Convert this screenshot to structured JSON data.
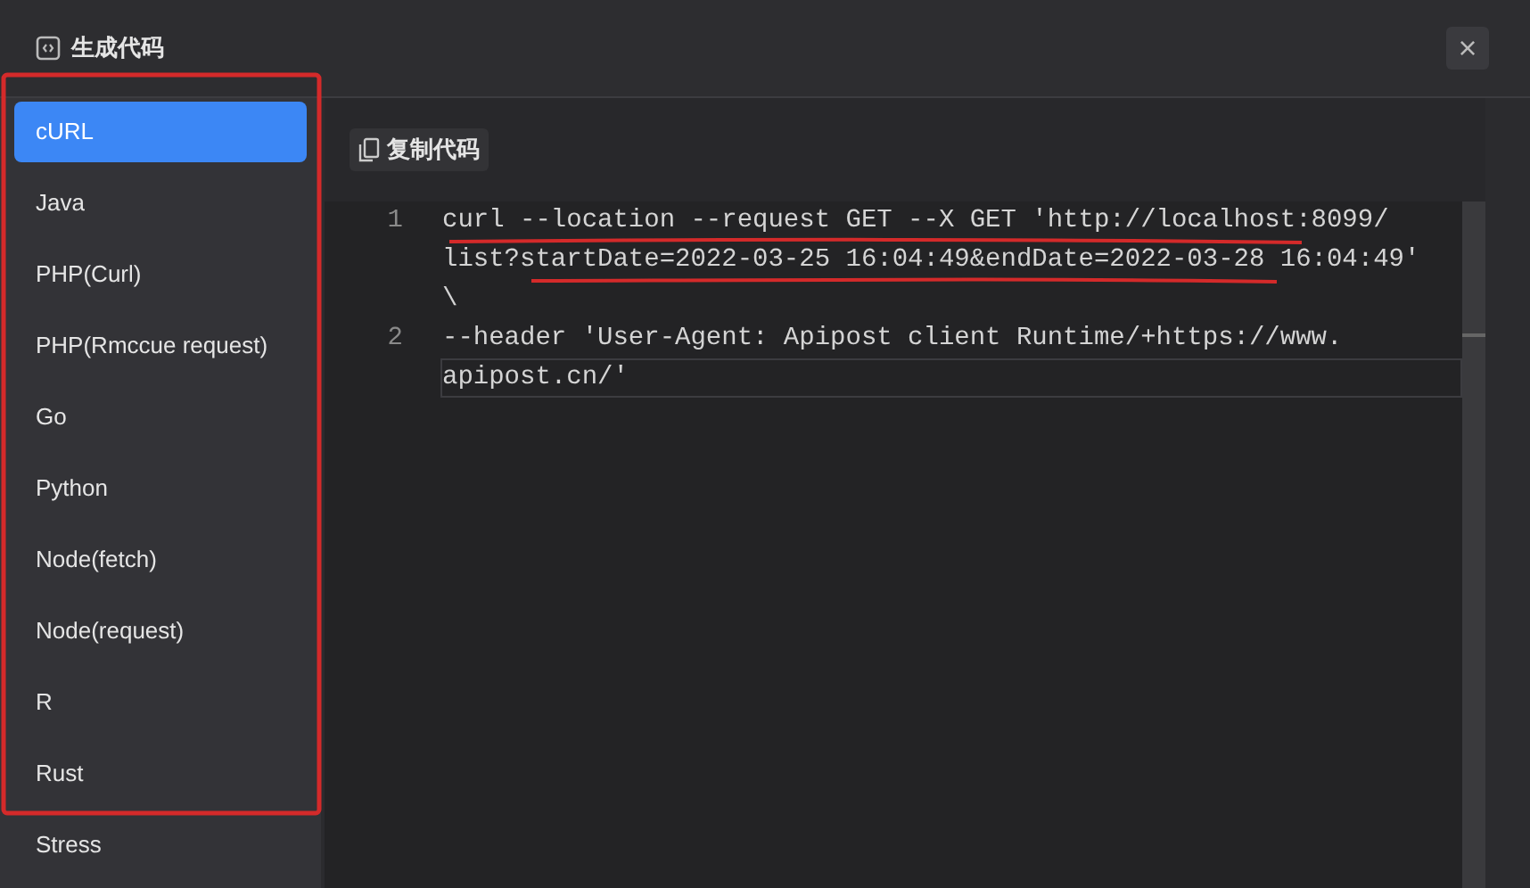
{
  "dialog": {
    "title": "生成代码",
    "close": "×"
  },
  "languages": [
    {
      "label": "cURL",
      "selected": true
    },
    {
      "label": "Java",
      "selected": false
    },
    {
      "label": "PHP(Curl)",
      "selected": false
    },
    {
      "label": "PHP(Rmccue request)",
      "selected": false
    },
    {
      "label": "Go",
      "selected": false
    },
    {
      "label": "Python",
      "selected": false
    },
    {
      "label": "Node(fetch)",
      "selected": false
    },
    {
      "label": "Node(request)",
      "selected": false
    },
    {
      "label": "R",
      "selected": false
    },
    {
      "label": "Rust",
      "selected": false
    },
    {
      "label": "Stress",
      "selected": false
    }
  ],
  "copy_button": "复制代码",
  "code_lines": [
    {
      "number": "1",
      "current": false,
      "wrapped": [
        "curl --location --request GET --X GET 'http://localhost:8099/",
        "list?startDate=2022-03-25 16:04:49&endDate=2022-03-28 16:04:49'",
        "\\"
      ]
    },
    {
      "number": "2",
      "current": true,
      "wrapped": [
        "--header 'User-Agent: Apipost client Runtime/+https://www.",
        "apipost.cn/'"
      ]
    }
  ]
}
